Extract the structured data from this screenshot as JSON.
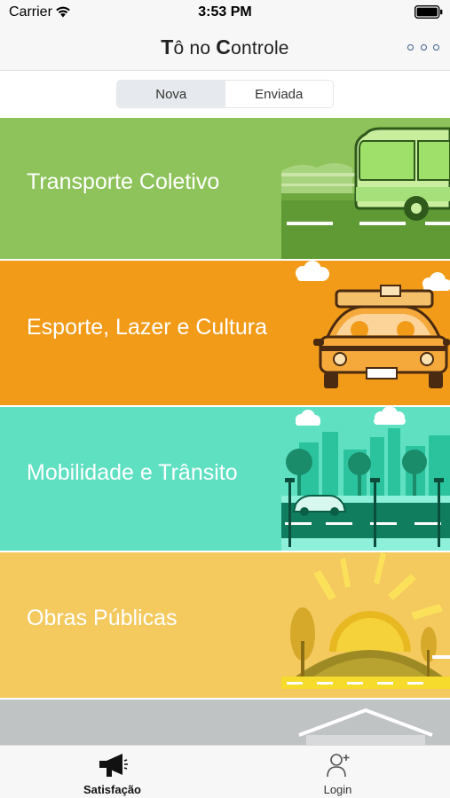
{
  "status_bar": {
    "carrier": "Carrier",
    "time": "3:53 PM",
    "wifi_icon": "wifi-icon",
    "battery_icon": "battery-icon"
  },
  "nav": {
    "title_parts": [
      "T",
      "ô no ",
      "C",
      "ontrole"
    ],
    "more_icon": "more-dots-icon"
  },
  "segments": {
    "items": [
      "Nova",
      "Enviada"
    ],
    "selected": "Nova"
  },
  "categories": [
    {
      "label": "Transporte Coletivo",
      "color": "#8dc35a",
      "icon": "bus-icon"
    },
    {
      "label": "Esporte, Lazer e Cultura",
      "color": "#f29b18",
      "icon": "car-icon"
    },
    {
      "label": "Mobilidade e Trânsito",
      "color": "#5ee0c1",
      "icon": "city-traffic-icon"
    },
    {
      "label": "Obras Públicas",
      "color": "#f4c95e",
      "icon": "sunrise-icon"
    },
    {
      "label": "",
      "color": "#bfc3c4",
      "icon": "building-icon"
    }
  ],
  "tab_bar": {
    "items": [
      {
        "label": "Satisfação",
        "icon": "megaphone-icon",
        "active": true
      },
      {
        "label": "Login",
        "icon": "user-add-icon",
        "active": false
      }
    ]
  }
}
